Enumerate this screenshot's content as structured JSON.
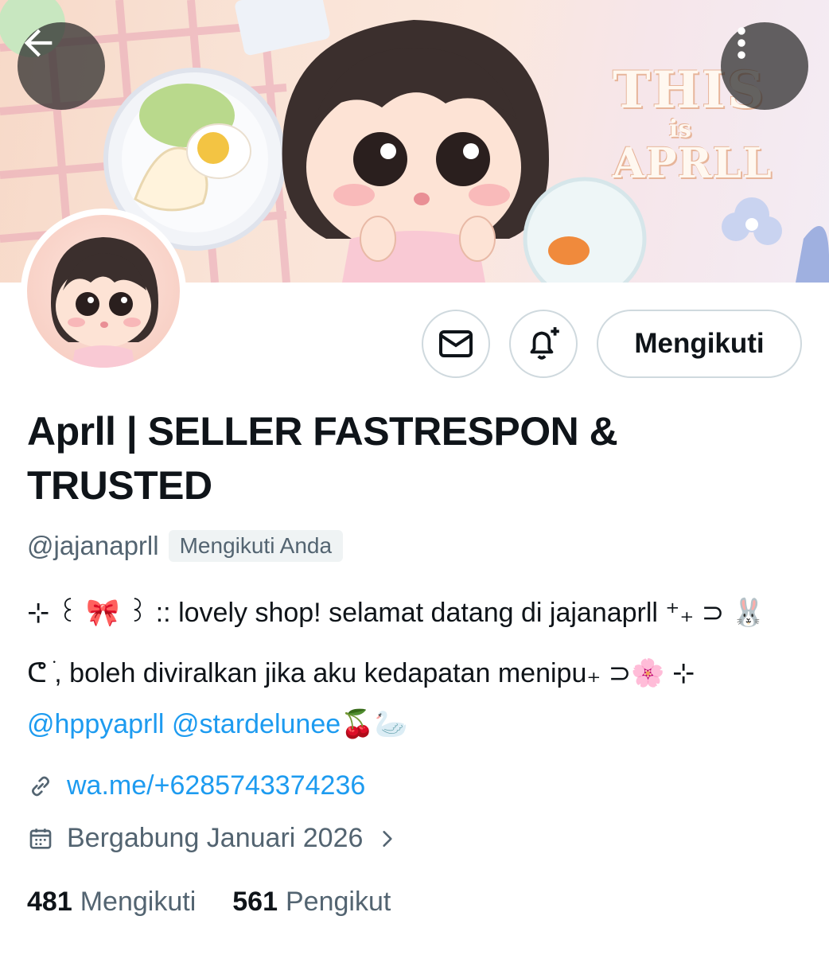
{
  "banner": {
    "title_line1": "THIS",
    "title_line2": "is",
    "title_line3": "APRLL"
  },
  "nav": {
    "back_icon": "arrow-left-icon",
    "more_icon": "more-vertical-icon"
  },
  "actions": {
    "message_icon": "envelope-icon",
    "notification_icon": "bell-plus-icon",
    "follow_label": "Mengikuti"
  },
  "profile": {
    "display_name": "Aprll | SELLER FASTRESPON & TRUSTED",
    "handle": "@jajanaprll",
    "follows_you_badge": "Mengikuti Anda",
    "bio": {
      "line1": "⊹ ꒰ 🎀 ꒱ :: lovely shop! selamat datang di jajanaprll ⁺₊ ⊃ 🐰",
      "line2": "ᕦ ֹ, boleh diviralkan jika aku kedapatan menipu₊ ⊃🌸 ⊹",
      "mention1": "@hppyaprll",
      "mention2": "@stardelunee",
      "line3_suffix": "🍒🦢"
    },
    "link": "wa.me/+6285743374236",
    "joined": "Bergabung Januari 2026"
  },
  "stats": {
    "following_count": "481",
    "following_label": "Mengikuti",
    "followers_count": "561",
    "followers_label": "Pengikut"
  },
  "colors": {
    "text_primary": "#0f1419",
    "text_secondary": "#536471",
    "accent_link": "#1d9bf0",
    "border": "#cfd9de"
  }
}
